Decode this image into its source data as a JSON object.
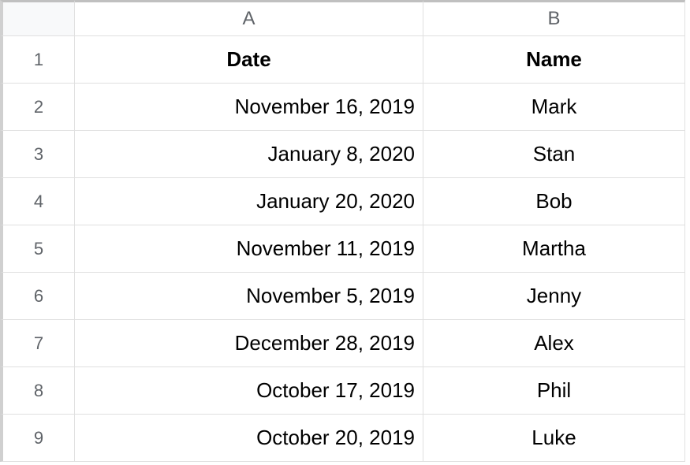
{
  "columns": [
    "A",
    "B"
  ],
  "row_numbers": [
    "1",
    "2",
    "3",
    "4",
    "5",
    "6",
    "7",
    "8",
    "9"
  ],
  "header_row": {
    "date": "Date",
    "name": "Name"
  },
  "rows": [
    {
      "date": "November 16, 2019",
      "name": "Mark"
    },
    {
      "date": "January 8, 2020",
      "name": "Stan"
    },
    {
      "date": "January 20, 2020",
      "name": "Bob"
    },
    {
      "date": "November 11, 2019",
      "name": "Martha"
    },
    {
      "date": "November 5, 2019",
      "name": "Jenny"
    },
    {
      "date": "December 28, 2019",
      "name": "Alex"
    },
    {
      "date": "October 17, 2019",
      "name": "Phil"
    },
    {
      "date": "October 20, 2019",
      "name": "Luke"
    }
  ]
}
